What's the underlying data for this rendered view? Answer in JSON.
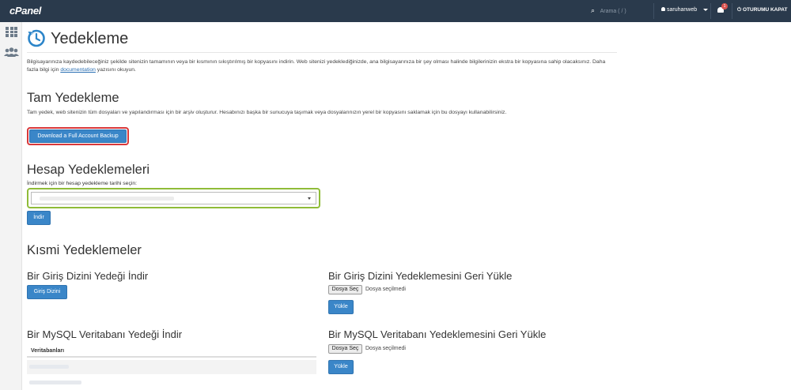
{
  "topbar": {
    "logo": "cPanel",
    "search_placeholder": "Arama ( / )",
    "username": "saruhanweb",
    "notification_count": "1",
    "logout_label": "OTURUMU KAPAT"
  },
  "page": {
    "title": "Yedekleme",
    "intro_before_link": "Bilgisayarınıza kaydedebileceğiniz şekilde sitenizin tamamının veya bir kısmının sıkıştırılmış bir kopyasını indirin. Web sitenizi yedeklediğinizde, ana bilgisayarınıza bir şey olması halinde bilgilerinizin ekstra bir kopyasına sahip olacaksınız. Daha fazla bilgi için ",
    "intro_link": "documentation",
    "intro_after_link": " yazısını okuyun."
  },
  "full_backup": {
    "heading": "Tam Yedekleme",
    "description": "Tam yedek, web sitenizin tüm dosyaları ve yapılandırması için bir arşiv oluşturur. Hesabınızı başka bir sunucuya taşımak veya dosyalarınızın yerel bir kopyasını saklamak için bu dosyayı kullanabilirsiniz.",
    "button_label": "Download a Full Account Backup"
  },
  "account_backups": {
    "heading": "Hesap Yedeklemeleri",
    "select_label": "İndirmek için bir hesap yedekleme tarihi seçin:",
    "download_button": "İndir"
  },
  "partial_backups": {
    "heading": "Kısmi Yedeklemeler",
    "home_download_heading": "Bir Giriş Dizini Yedeği İndir",
    "home_download_button": "Giriş Dizini",
    "home_restore_heading": "Bir Giriş Dizini Yedeklemesini Geri Yükle",
    "mysql_download_heading": "Bir MySQL Veritabanı Yedeği İndir",
    "mysql_restore_heading": "Bir MySQL Veritabanı Yedeklemesini Geri Yükle",
    "databases_header": "Veritabanları",
    "file_choose_label": "Dosya Seç",
    "file_none_label": "Dosya seçilmedi",
    "upload_button": "Yükle"
  }
}
